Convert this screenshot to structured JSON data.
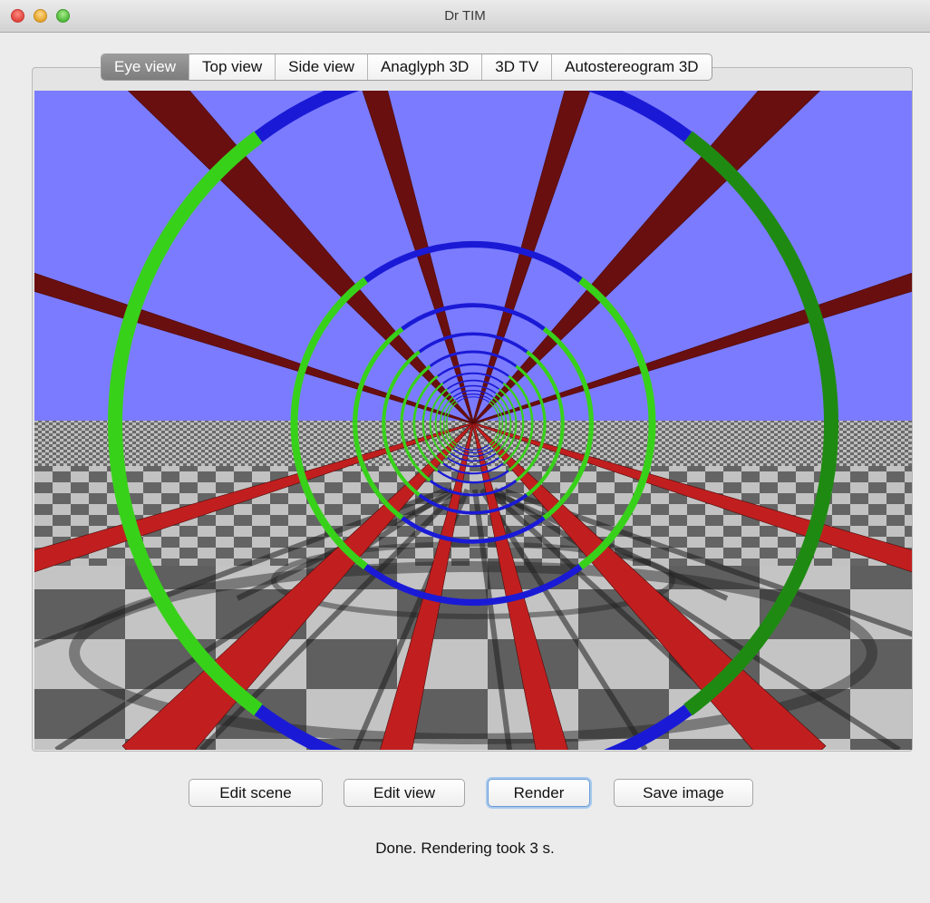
{
  "window": {
    "title": "Dr TIM"
  },
  "tabs": [
    {
      "label": "Eye view",
      "selected": true
    },
    {
      "label": "Top view",
      "selected": false
    },
    {
      "label": "Side view",
      "selected": false
    },
    {
      "label": "Anaglyph 3D",
      "selected": false
    },
    {
      "label": "3D TV",
      "selected": false
    },
    {
      "label": "Autostereogram 3D",
      "selected": false
    }
  ],
  "buttons": {
    "edit_scene": "Edit scene",
    "edit_view": "Edit view",
    "render": "Render",
    "save_image": "Save image"
  },
  "status": {
    "text": "Done.  Rendering took 3 s."
  },
  "colors": {
    "sky": "#7b7bff",
    "floor_light": "#c0c0c0",
    "floor_dark": "#5e5e5e",
    "rod_red": "#c11f1f",
    "ring_green": "#38d11a",
    "ring_blue": "#1a1ad6"
  }
}
